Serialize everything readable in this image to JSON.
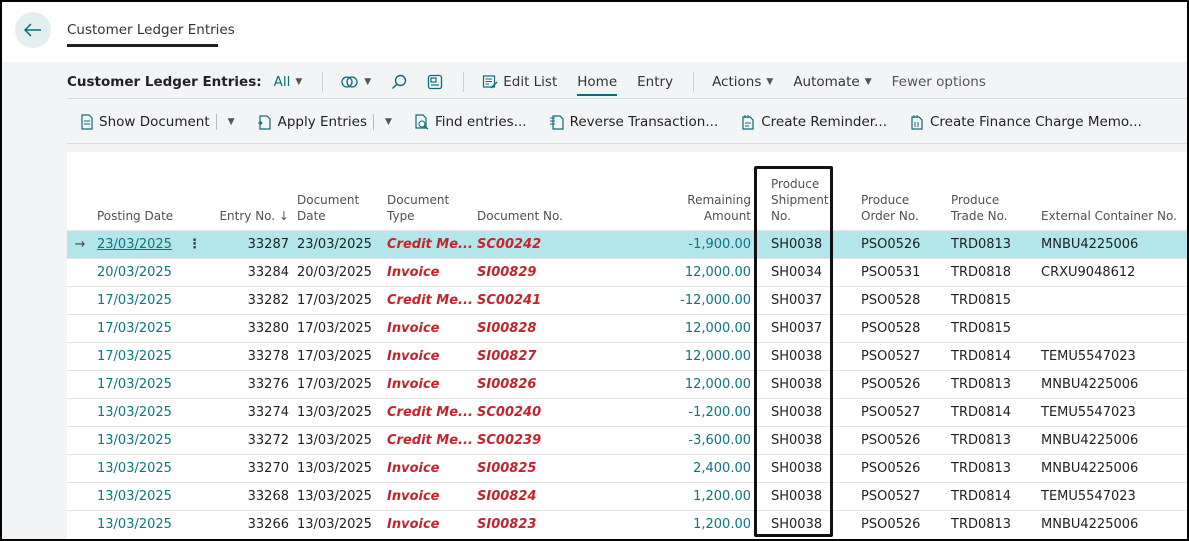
{
  "page": {
    "tab_title": "Customer Ledger Entries"
  },
  "actionbar": {
    "title": "Customer Ledger Entries:",
    "filter": "All",
    "edit_list": "Edit List",
    "home": "Home",
    "entry": "Entry",
    "actions": "Actions",
    "automate": "Automate",
    "fewer_options": "Fewer options"
  },
  "commands": {
    "show_document": "Show Document",
    "apply_entries": "Apply Entries",
    "find_entries": "Find entries...",
    "reverse_transaction": "Reverse Transaction...",
    "create_reminder": "Create Reminder...",
    "create_finance_charge_memo": "Create Finance Charge Memo..."
  },
  "columns": {
    "posting_date": "Posting Date",
    "entry_no": "Entry No. ↓",
    "document_date_1": "Document",
    "document_date_2": "Date",
    "document_type_1": "Document",
    "document_type_2": "Type",
    "document_no": "Document No.",
    "remaining_1": "Remaining",
    "remaining_2": "Amount",
    "shipment_1": "Produce",
    "shipment_2": "Shipment",
    "shipment_3": "No.",
    "order_1": "Produce",
    "order_2": "Order No.",
    "trade_1": "Produce",
    "trade_2": "Trade No.",
    "container": "External Container No."
  },
  "rows": [
    {
      "posting_date": "23/03/2025",
      "entry_no": "33287",
      "document_date": "23/03/2025",
      "document_type": "Credit Me...",
      "document_no": "SC00242",
      "remaining": "-1,900.00",
      "shipment": "SH0038",
      "order": "PSO0526",
      "trade": "TRD0813",
      "container": "MNBU4225006"
    },
    {
      "posting_date": "20/03/2025",
      "entry_no": "33284",
      "document_date": "20/03/2025",
      "document_type": "Invoice",
      "document_no": "SI00829",
      "remaining": "12,000.00",
      "shipment": "SH0034",
      "order": "PSO0531",
      "trade": "TRD0818",
      "container": "CRXU9048612"
    },
    {
      "posting_date": "17/03/2025",
      "entry_no": "33282",
      "document_date": "17/03/2025",
      "document_type": "Credit Me...",
      "document_no": "SC00241",
      "remaining": "-12,000.00",
      "shipment": "SH0037",
      "order": "PSO0528",
      "trade": "TRD0815",
      "container": ""
    },
    {
      "posting_date": "17/03/2025",
      "entry_no": "33280",
      "document_date": "17/03/2025",
      "document_type": "Invoice",
      "document_no": "SI00828",
      "remaining": "12,000.00",
      "shipment": "SH0037",
      "order": "PSO0528",
      "trade": "TRD0815",
      "container": ""
    },
    {
      "posting_date": "17/03/2025",
      "entry_no": "33278",
      "document_date": "17/03/2025",
      "document_type": "Invoice",
      "document_no": "SI00827",
      "remaining": "12,000.00",
      "shipment": "SH0038",
      "order": "PSO0527",
      "trade": "TRD0814",
      "container": "TEMU5547023"
    },
    {
      "posting_date": "17/03/2025",
      "entry_no": "33276",
      "document_date": "17/03/2025",
      "document_type": "Invoice",
      "document_no": "SI00826",
      "remaining": "12,000.00",
      "shipment": "SH0038",
      "order": "PSO0526",
      "trade": "TRD0813",
      "container": "MNBU4225006"
    },
    {
      "posting_date": "13/03/2025",
      "entry_no": "33274",
      "document_date": "13/03/2025",
      "document_type": "Credit Me...",
      "document_no": "SC00240",
      "remaining": "-1,200.00",
      "shipment": "SH0038",
      "order": "PSO0527",
      "trade": "TRD0814",
      "container": "TEMU5547023"
    },
    {
      "posting_date": "13/03/2025",
      "entry_no": "33272",
      "document_date": "13/03/2025",
      "document_type": "Credit Me...",
      "document_no": "SC00239",
      "remaining": "-3,600.00",
      "shipment": "SH0038",
      "order": "PSO0526",
      "trade": "TRD0813",
      "container": "MNBU4225006"
    },
    {
      "posting_date": "13/03/2025",
      "entry_no": "33270",
      "document_date": "13/03/2025",
      "document_type": "Invoice",
      "document_no": "SI00825",
      "remaining": "2,400.00",
      "shipment": "SH0038",
      "order": "PSO0526",
      "trade": "TRD0813",
      "container": "MNBU4225006"
    },
    {
      "posting_date": "13/03/2025",
      "entry_no": "33268",
      "document_date": "13/03/2025",
      "document_type": "Invoice",
      "document_no": "SI00824",
      "remaining": "1,200.00",
      "shipment": "SH0038",
      "order": "PSO0527",
      "trade": "TRD0814",
      "container": "TEMU5547023"
    },
    {
      "posting_date": "13/03/2025",
      "entry_no": "33266",
      "document_date": "13/03/2025",
      "document_type": "Invoice",
      "document_no": "SI00823",
      "remaining": "1,200.00",
      "shipment": "SH0038",
      "order": "PSO0526",
      "trade": "TRD0813",
      "container": "MNBU4225006"
    }
  ],
  "colors": {
    "accent": "#0e7480",
    "selected_row": "#b3e6ea",
    "document_red": "#c0262c"
  }
}
